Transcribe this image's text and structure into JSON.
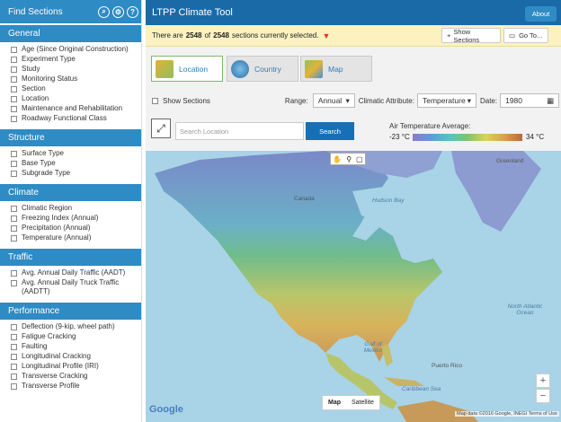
{
  "sidebar": {
    "title": "Find Sections",
    "icons": [
      "binoculars-icon",
      "settings-icon",
      "help-icon"
    ],
    "help_glyph": "?",
    "sections": [
      {
        "heading": "General",
        "items": [
          "Age (Since Original Construction)",
          "Experiment Type",
          "Study",
          "Monitoring Status",
          "Section",
          "Location",
          "Maintenance and Rehabilitation",
          "Roadway Functional Class"
        ]
      },
      {
        "heading": "Structure",
        "items": [
          "Surface Type",
          "Base Type",
          "Subgrade Type"
        ]
      },
      {
        "heading": "Climate",
        "items": [
          "Climatic Region",
          "Freezing Index (Annual)",
          "Precipitation (Annual)",
          "Temperature (Annual)"
        ]
      },
      {
        "heading": "Traffic",
        "items": [
          "Avg. Annual Daily Traffic (AADT)",
          "Avg. Annual Daily Truck Traffic (AADTT)"
        ]
      },
      {
        "heading": "Performance",
        "items": [
          "Deflection (9-kip, wheel path)",
          "Fatigue Cracking",
          "Faulting",
          "Longitudinal Cracking",
          "Longitudinal Profile (IRI)",
          "Transverse Cracking",
          "Transverse Profile"
        ]
      }
    ]
  },
  "app": {
    "title": "LTPP Climate Tool",
    "about_label": "About"
  },
  "selection": {
    "prefix": "There are",
    "selected": "2548",
    "of": "of",
    "total": "2548",
    "suffix": "sections currently selected.",
    "show_sections_label": "Show Sections",
    "goto_label": "Go To..."
  },
  "tabs": [
    {
      "label": "Location",
      "active": true
    },
    {
      "label": "Country",
      "active": false
    },
    {
      "label": "Map",
      "active": false
    }
  ],
  "controls": {
    "show_sections_label": "Show Sections",
    "range_label": "Range:",
    "range_value": "Annual",
    "attribute_label": "Climatic Attribute:",
    "attribute_value": "Temperature",
    "date_label": "Date:",
    "date_value": "1980"
  },
  "search": {
    "placeholder": "Search Location",
    "button_label": "Search"
  },
  "legend": {
    "title": "Air Temperature Average:",
    "min": "-23 °C",
    "max": "34 °C"
  },
  "map": {
    "labels": {
      "greenland": "Greenland",
      "canada": "Canada",
      "hudson_bay": "Hudson Bay",
      "gulf": "Gulf of Mexico",
      "atlantic": "North Atlantic Ocean",
      "puerto_rico": "Puerto Rico",
      "caribbean": "Caribbean Sea"
    },
    "maptype_map": "Map",
    "maptype_satellite": "Satellite",
    "google": "Google",
    "attribution": "Map data ©2016 Google, INEGI   Terms of Use",
    "zoom_in": "+",
    "zoom_out": "−"
  },
  "colors": {
    "header": "#2e8bc4",
    "app_bar": "#1b6aa8",
    "banner": "#fbf2c0",
    "search_button": "#1570b8"
  }
}
